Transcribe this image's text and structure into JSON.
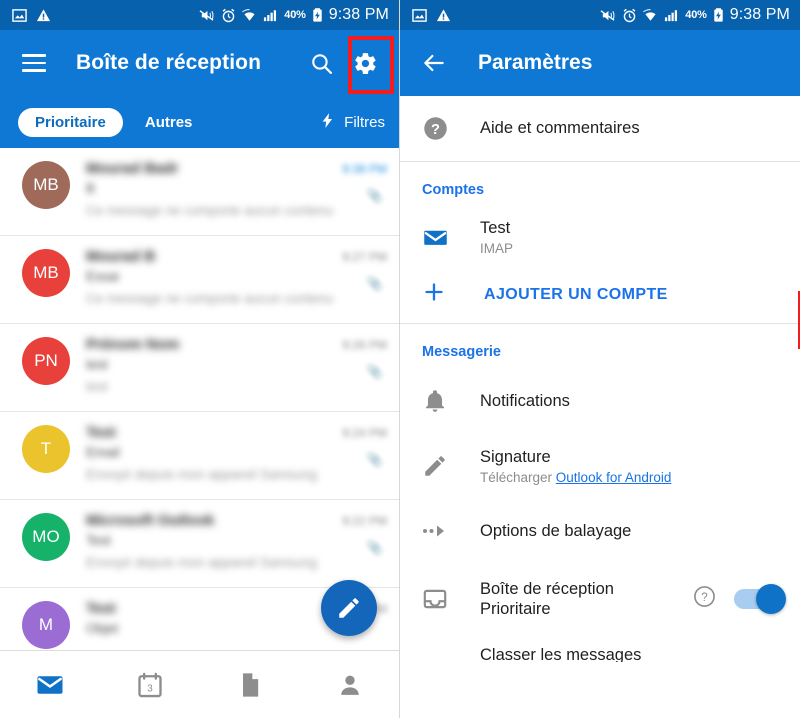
{
  "status_bar": {
    "time": "9:38 PM",
    "battery_percent": "40%",
    "icons": [
      "image-icon",
      "warning-icon",
      "mute-vibrate-icon",
      "alarm-icon",
      "wifi-icon",
      "signal-icon",
      "battery-charging-icon"
    ]
  },
  "colors": {
    "appbar_blue": "#0f78d4",
    "statusbar_blue": "#0761ad",
    "accent_blue": "#1a73e8",
    "highlight_red": "#f41c1c",
    "fab_blue": "#1466bb",
    "toggle_on": "#1072c6"
  },
  "left_panel": {
    "title": "Boîte de réception",
    "menu_icon": "hamburger-menu-icon",
    "search_icon": "search-icon",
    "settings_icon": "gear-icon",
    "tabs": [
      {
        "label": "Prioritaire",
        "selected": true
      },
      {
        "label": "Autres",
        "selected": false
      }
    ],
    "filters_label": "Filtres",
    "filters_icon": "lightning-bolt-icon",
    "compose_fab": {
      "icon": "pencil-icon",
      "label": "Nouveau message"
    },
    "emails": [
      {
        "initials": "MB",
        "color": "#a06a5b",
        "unread": true,
        "sender": "Mourad Badr",
        "time": "9:38 PM",
        "subject": "B",
        "preview": "Ce message ne comporte aucun contenu",
        "attachment": true
      },
      {
        "initials": "MB",
        "color": "#e8403a",
        "unread": false,
        "sender": "Mourad B",
        "time": "9:27 PM",
        "subject": "Essai",
        "preview": "Ce message ne comporte aucun contenu",
        "attachment": true
      },
      {
        "initials": "PN",
        "color": "#e8403a",
        "unread": false,
        "sender": "Prénom Nom",
        "time": "9:26 PM",
        "subject": "test",
        "preview": "test",
        "attachment": true
      },
      {
        "initials": "T",
        "color": "#ebc32d",
        "unread": false,
        "sender": "Test",
        "time": "9:24 PM",
        "subject": "Email",
        "preview": "Envoyé depuis mon appareil Samsung",
        "attachment": true
      },
      {
        "initials": "MO",
        "color": "#17b26a",
        "unread": false,
        "sender": "Microsoft Outlook",
        "time": "9:22 PM",
        "subject": "Test",
        "preview": "Envoyé depuis mon appareil Samsung",
        "attachment": true
      },
      {
        "initials": "M",
        "color": "#9b6cd4",
        "unread": false,
        "sender": "Test",
        "time": "9:20 PM",
        "subject": "Objet",
        "preview": "",
        "attachment": false
      }
    ],
    "bottom_nav": [
      {
        "name": "mail",
        "icon": "envelope-icon",
        "active": true
      },
      {
        "name": "calendar",
        "icon": "calendar-icon",
        "badge": "3",
        "active": false
      },
      {
        "name": "files",
        "icon": "file-icon",
        "active": false
      },
      {
        "name": "people",
        "icon": "person-icon",
        "active": false
      }
    ]
  },
  "right_panel": {
    "title": "Paramètres",
    "back_icon": "back-arrow-icon",
    "help_row": {
      "label": "Aide et commentaires",
      "icon": "help-circle-icon"
    },
    "accounts_section": {
      "header": "Comptes",
      "account": {
        "name": "Test",
        "type": "IMAP",
        "icon": "envelope-icon"
      },
      "add_account": {
        "label": "AJOUTER UN COMPTE",
        "icon": "plus-icon",
        "highlighted": true
      }
    },
    "mail_section": {
      "header": "Messagerie",
      "rows": [
        {
          "label": "Notifications",
          "icon": "bell-icon",
          "sub": "",
          "link": ""
        },
        {
          "label": "Signature",
          "icon": "pencil-icon",
          "sub": "Télécharger ",
          "link": "Outlook for Android"
        },
        {
          "label": "Options de balayage",
          "icon": "swipe-icon",
          "sub": "",
          "link": ""
        },
        {
          "label": "Boîte de réception Prioritaire",
          "icon": "inbox-icon",
          "sub": "",
          "link": "",
          "help_icon": "help-circle-outline-icon",
          "toggle": true
        }
      ],
      "cut_off_row": "Classer les messages"
    }
  }
}
